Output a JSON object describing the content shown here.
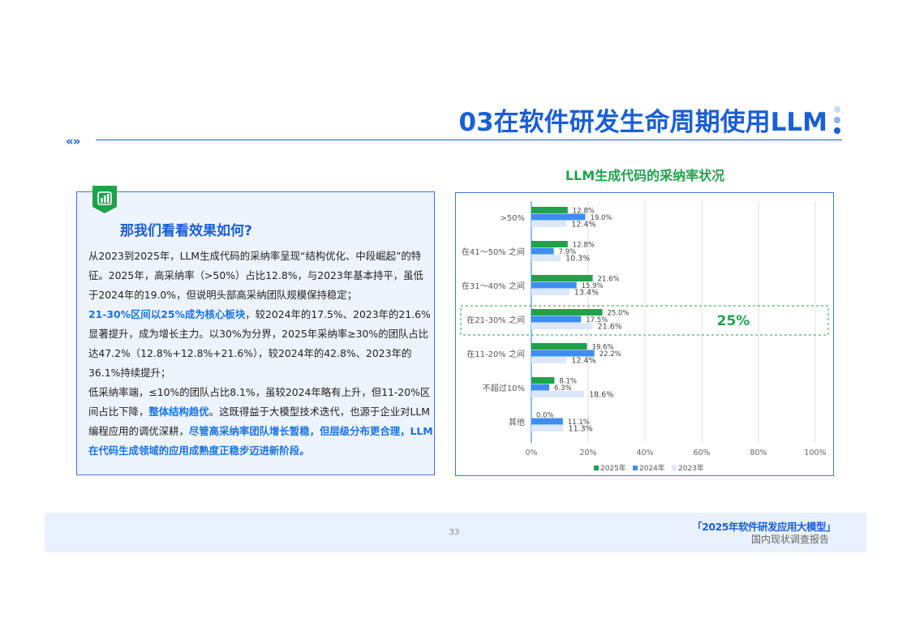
{
  "header": {
    "title": "03在软件研发生命周期使用LLM",
    "chevron": "«»",
    "dot_colors": [
      "#c9dcf7",
      "#8db4ee",
      "#1a5fd6"
    ]
  },
  "card": {
    "heading": "那我们看看效果如何?",
    "icon": "bar-chart-icon",
    "p1": "从2023到2025年，LLM生成代码的采纳率呈现“结构优化、中段崛起”的特征。2025年，高采纳率（>50%）占比12.8%，与2023年基本持平，虽低于2024年的19.0%，但说明头部高采纳团队规模保持稳定；",
    "p2_hl": "21-30%区间以25%成为核心板块",
    "p2_rest": "，较2024年的17.5%、2023年的21.6%显著提升，成为增长主力。以30%为分界，2025年采纳率≥30%的团队占比达47.2%（12.8%+12.8%+21.6%），较2024年的42.8%、2023年的36.1%持续提升；",
    "p3_a": "低采纳率端，≤10%的团队占比8.1%，虽较2024年略有上升，但11-20%区间占比下降，",
    "p3_hl1": "整体结构趋优",
    "p3_b": "。这既得益于大模型技术迭代，也源于企业对LLM编程应用的调优深耕，",
    "p3_hl2": "尽管高采纳率团队增长暂稳，但层级分布更合理，LLM在代码生成领域的应用成熟度正稳步迈进新阶段。"
  },
  "chart_data": {
    "type": "bar",
    "orientation": "horizontal",
    "title": "LLM生成代码的采纳率状况",
    "categories": [
      ">50%",
      "在41～50% 之间",
      "在31～40% 之间",
      "在21-30% 之间",
      "在11-20% 之间",
      "不超过10%",
      "其他"
    ],
    "series": [
      {
        "name": "2025年",
        "color": "#1fa24a",
        "values": [
          12.8,
          12.8,
          21.6,
          25.0,
          19.6,
          8.1,
          0.0
        ]
      },
      {
        "name": "2024年",
        "color": "#3d8ef0",
        "values": [
          19.0,
          7.9,
          15.9,
          17.5,
          22.2,
          6.3,
          11.1
        ]
      },
      {
        "name": "2023年",
        "color": "#dce8f8",
        "values": [
          12.4,
          10.3,
          13.4,
          21.6,
          12.4,
          18.6,
          11.3
        ]
      }
    ],
    "xlim": [
      0,
      100
    ],
    "xticks": [
      "0%",
      "20%",
      "40%",
      "60%",
      "80%",
      "100%"
    ],
    "highlight": {
      "category": "在21-30% 之间",
      "label": "25%",
      "color": "#1fa24a"
    },
    "legend": "bottom",
    "grid": true
  },
  "footer": {
    "page": "33",
    "report_line1": "「2025年软件研发应用大模型」",
    "report_line2": "国内现状调查报告"
  }
}
